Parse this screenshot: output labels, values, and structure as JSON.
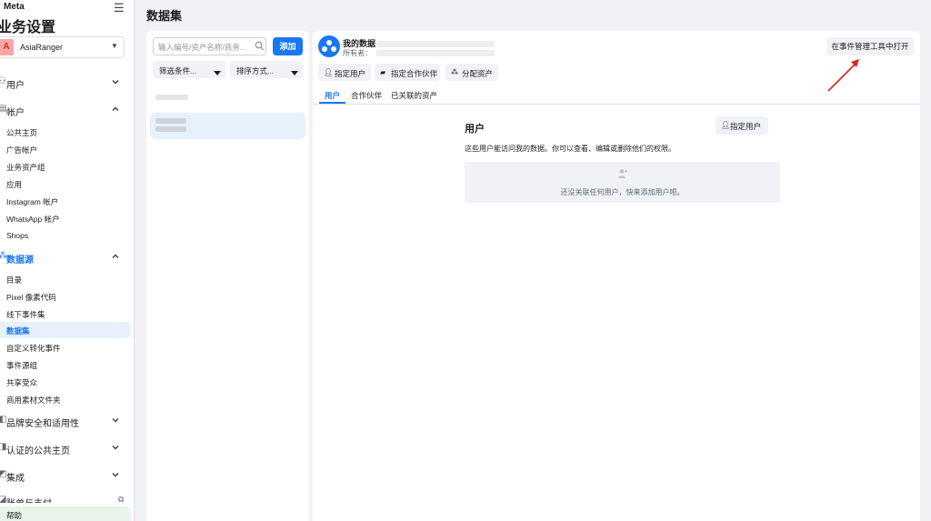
{
  "sidebar": {
    "brand": "Meta",
    "title": "业务设置",
    "account": {
      "initial": "A",
      "name": "AsiaRanger"
    },
    "sections": {
      "users": "用户",
      "accounts": "帐户",
      "data_sources": "数据源",
      "brand_safety": "品牌安全和适用性",
      "verified_pages": "认证的公共主页",
      "integrations": "集成",
      "billing": "账单与支付"
    },
    "account_items": [
      "公共主页",
      "广告帐户",
      "业务资产组",
      "应用",
      "Instagram 帐户",
      "WhatsApp 帐户",
      "Shops"
    ],
    "data_items": [
      "目录",
      "Pixel 像素代码",
      "线下事件集",
      "数据集",
      "自定义转化事件",
      "事件源组",
      "共享受众",
      "商用素材文件夹"
    ],
    "active_data_item": "数据集",
    "help": "帮助"
  },
  "header": {
    "title": "数据集"
  },
  "list": {
    "search_placeholder": "输入编号/资产名称/商务...",
    "add_label": "添加",
    "filter_label": "筛选条件...",
    "sort_label": "排序方式..."
  },
  "detail": {
    "name": "我的数据",
    "owner_label": "所有者：",
    "open_button": "在事件管理工具中打开",
    "actions": [
      "指定用户",
      "指定合作伙伴",
      "分配资产"
    ],
    "tabs": [
      "用户",
      "合作伙伴",
      "已关联的资产"
    ],
    "active_tab": "用户",
    "users": {
      "title": "用户",
      "assign_button": "指定用户",
      "description": "这些用户能访问我的数据。你可以查看、编辑或删除他们的权限。",
      "empty_text": "还没关联任何用户，快来添加用户吧。"
    }
  },
  "colors": {
    "accent": "#1877f2",
    "annotation": "#e02020"
  }
}
